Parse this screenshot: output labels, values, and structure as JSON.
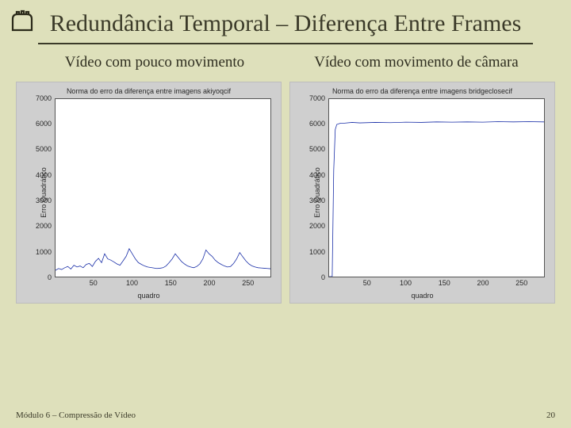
{
  "slide": {
    "title": "Redundância Temporal – Diferença Entre Frames",
    "subtitle_left": "Vídeo com pouco movimento",
    "subtitle_right": "Vídeo com movimento de câmara",
    "footer_left": "Módulo 6 – Compressão de Vídeo",
    "footer_right": "20"
  },
  "chart_data": [
    {
      "type": "line",
      "title": "Norma do erro da diferença entre imagens akiyoqcif",
      "xlabel": "quadro",
      "ylabel": "Erro Quadrático",
      "xlim": [
        0,
        280
      ],
      "ylim": [
        0,
        7000
      ],
      "xticks": [
        50,
        100,
        150,
        200,
        250
      ],
      "yticks": [
        0,
        1000,
        2000,
        3000,
        4000,
        5000,
        6000,
        7000
      ],
      "series": [
        {
          "name": "akiyoqcif",
          "color": "#1a2fa8",
          "x": [
            0,
            4,
            8,
            12,
            16,
            20,
            24,
            28,
            32,
            36,
            40,
            44,
            48,
            52,
            56,
            60,
            64,
            68,
            72,
            76,
            80,
            84,
            88,
            92,
            96,
            100,
            104,
            108,
            112,
            116,
            120,
            124,
            128,
            132,
            136,
            140,
            144,
            148,
            152,
            156,
            160,
            164,
            168,
            172,
            176,
            180,
            184,
            188,
            192,
            196,
            200,
            204,
            208,
            212,
            216,
            220,
            224,
            228,
            232,
            236,
            240,
            244,
            248,
            252,
            256,
            260,
            264,
            268,
            272,
            276,
            280
          ],
          "values": [
            250,
            320,
            280,
            350,
            400,
            300,
            450,
            380,
            420,
            350,
            480,
            520,
            400,
            600,
            720,
            550,
            900,
            700,
            650,
            580,
            500,
            450,
            620,
            800,
            1100,
            900,
            700,
            550,
            480,
            420,
            380,
            360,
            340,
            320,
            330,
            350,
            420,
            550,
            700,
            900,
            750,
            600,
            500,
            420,
            380,
            350,
            400,
            500,
            700,
            1050,
            900,
            800,
            650,
            550,
            480,
            420,
            380,
            400,
            520,
            700,
            950,
            780,
            620,
            500,
            420,
            380,
            350,
            340,
            330,
            320,
            310
          ]
        }
      ]
    },
    {
      "type": "line",
      "title": "Norma do erro da diferença entre imagens bridgeclosecif",
      "xlabel": "quadro",
      "ylabel": "Erro Quadrático",
      "xlim": [
        0,
        280
      ],
      "ylim": [
        0,
        7000
      ],
      "xticks": [
        50,
        100,
        150,
        200,
        250
      ],
      "yticks": [
        0,
        1000,
        2000,
        3000,
        4000,
        5000,
        6000,
        7000
      ],
      "series": [
        {
          "name": "bridgeclosecif",
          "color": "#1a2fa8",
          "x": [
            0,
            2,
            4,
            6,
            8,
            10,
            15,
            20,
            30,
            40,
            60,
            80,
            100,
            120,
            140,
            160,
            180,
            200,
            220,
            240,
            260,
            280
          ],
          "values": [
            0,
            0,
            0,
            4200,
            5800,
            6000,
            6050,
            6050,
            6080,
            6060,
            6080,
            6070,
            6090,
            6080,
            6100,
            6090,
            6100,
            6090,
            6110,
            6100,
            6110,
            6100
          ]
        }
      ]
    }
  ]
}
